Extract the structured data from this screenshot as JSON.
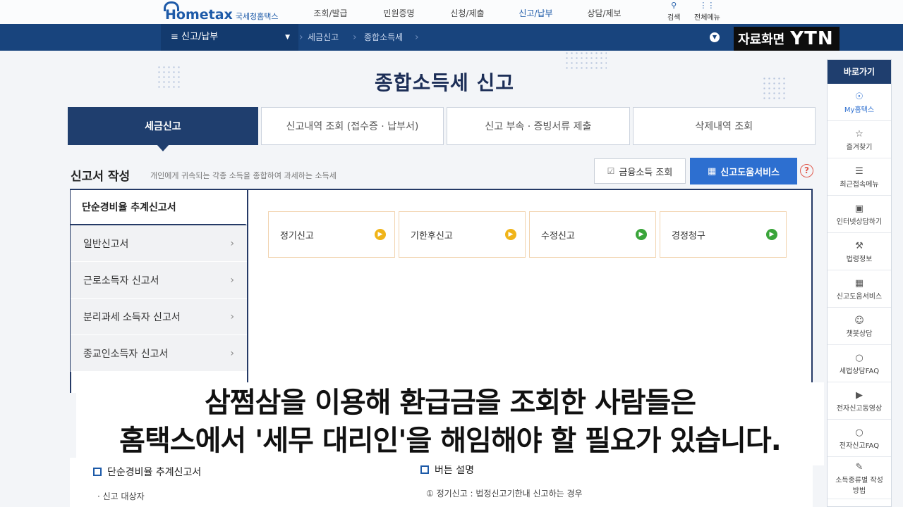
{
  "header": {
    "logo_text": "Hometax",
    "logo_sub": "국세청홈택스",
    "nav": [
      "조회/발급",
      "민원증명",
      "신청/제출",
      "신고/납부",
      "상담/제보"
    ],
    "active_nav_index": 3,
    "search_label": "검색",
    "menu_label": "전체메뉴"
  },
  "breadcrumb": {
    "level1": "신고/납부",
    "level2": "세금신고",
    "level3": "종합소득세"
  },
  "broadcast": {
    "caption": "자료화면",
    "logo": "YTN"
  },
  "page": {
    "title": "종합소득세 신고"
  },
  "tabs": [
    {
      "label": "세금신고"
    },
    {
      "label": "신고내역 조회 (접수증 · 납부서)"
    },
    {
      "label": "신고 부속 · 증빙서류 제출"
    },
    {
      "label": "삭제내역 조회"
    }
  ],
  "section": {
    "title": "신고서 작성",
    "description": "개인에게 귀속되는 각종 소득을 종합하여 과세하는 소득세",
    "fin_button": "금융소득 조회",
    "help_button": "신고도움서비스"
  },
  "left_menu": {
    "header": "단순경비율 추계신고서",
    "items": [
      "일반신고서",
      "근로소득자 신고서",
      "분리과세 소득자 신고서",
      "종교인소득자 신고서"
    ]
  },
  "cards": [
    {
      "label": "정기신고",
      "color": "#f0b419"
    },
    {
      "label": "기한후신고",
      "color": "#f0b419"
    },
    {
      "label": "수정신고",
      "color": "#3aa53a"
    },
    {
      "label": "경정청구",
      "color": "#3aa53a"
    }
  ],
  "bottom": {
    "left_title": "단순경비율 추계신고서",
    "left_sub": "· 신고 대상자",
    "right_title": "버튼 설명",
    "right_sub": "① 정기신고 : 법정신고기한내 신고하는 경우"
  },
  "quickbar": {
    "title": "바로가기",
    "items": [
      {
        "label": "My홈택스",
        "icon": "person-icon"
      },
      {
        "label": "즐겨찾기",
        "icon": "star-icon"
      },
      {
        "label": "최근접속메뉴",
        "icon": "recent-icon"
      },
      {
        "label": "인터넷상담하기",
        "icon": "monitor-icon"
      },
      {
        "label": "법령정보",
        "icon": "gavel-icon"
      },
      {
        "label": "신고도움서비스",
        "icon": "book-icon"
      },
      {
        "label": "챗봇상담",
        "icon": "chatbot-icon"
      },
      {
        "label": "세법상담FAQ",
        "icon": "chat-icon"
      },
      {
        "label": "전자신고동영상",
        "icon": "video-icon"
      },
      {
        "label": "전자신고FAQ",
        "icon": "chat-icon"
      },
      {
        "label": "소득종류별 작성방법",
        "icon": "edit-icon"
      }
    ]
  },
  "subtitles": {
    "line1": "삼쩜삼을 이용해 환급금을 조회한 사람들은",
    "line2": "홈택스에서 '세무 대리인'을 해임해야 할 필요가 있습니다."
  }
}
